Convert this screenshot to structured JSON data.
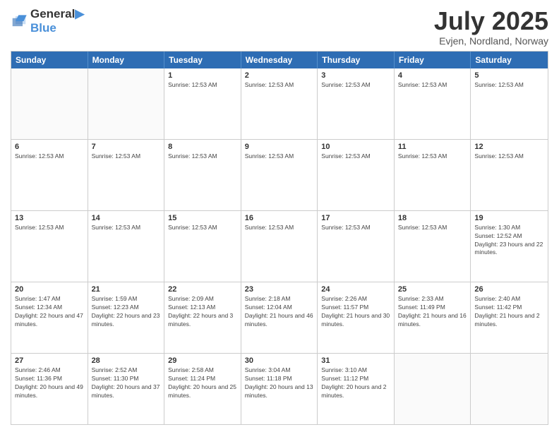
{
  "header": {
    "logo_line1": "General",
    "logo_line2": "Blue",
    "title": "July 2025",
    "subtitle": "Evjen, Nordland, Norway"
  },
  "weekdays": [
    "Sunday",
    "Monday",
    "Tuesday",
    "Wednesday",
    "Thursday",
    "Friday",
    "Saturday"
  ],
  "rows": [
    [
      {
        "day": "",
        "info": ""
      },
      {
        "day": "",
        "info": ""
      },
      {
        "day": "1",
        "info": "Sunrise: 12:53 AM"
      },
      {
        "day": "2",
        "info": "Sunrise: 12:53 AM"
      },
      {
        "day": "3",
        "info": "Sunrise: 12:53 AM"
      },
      {
        "day": "4",
        "info": "Sunrise: 12:53 AM"
      },
      {
        "day": "5",
        "info": "Sunrise: 12:53 AM"
      }
    ],
    [
      {
        "day": "6",
        "info": "Sunrise: 12:53 AM"
      },
      {
        "day": "7",
        "info": "Sunrise: 12:53 AM"
      },
      {
        "day": "8",
        "info": "Sunrise: 12:53 AM"
      },
      {
        "day": "9",
        "info": "Sunrise: 12:53 AM"
      },
      {
        "day": "10",
        "info": "Sunrise: 12:53 AM"
      },
      {
        "day": "11",
        "info": "Sunrise: 12:53 AM"
      },
      {
        "day": "12",
        "info": "Sunrise: 12:53 AM"
      }
    ],
    [
      {
        "day": "13",
        "info": "Sunrise: 12:53 AM"
      },
      {
        "day": "14",
        "info": "Sunrise: 12:53 AM"
      },
      {
        "day": "15",
        "info": "Sunrise: 12:53 AM"
      },
      {
        "day": "16",
        "info": "Sunrise: 12:53 AM"
      },
      {
        "day": "17",
        "info": "Sunrise: 12:53 AM"
      },
      {
        "day": "18",
        "info": "Sunrise: 12:53 AM"
      },
      {
        "day": "19",
        "info": "Sunrise: 1:30 AM\nSunset: 12:52 AM\nDaylight: 23 hours and 22 minutes."
      }
    ],
    [
      {
        "day": "20",
        "info": "Sunrise: 1:47 AM\nSunset: 12:34 AM\nDaylight: 22 hours and 47 minutes."
      },
      {
        "day": "21",
        "info": "Sunrise: 1:59 AM\nSunset: 12:23 AM\nDaylight: 22 hours and 23 minutes."
      },
      {
        "day": "22",
        "info": "Sunrise: 2:09 AM\nSunset: 12:13 AM\nDaylight: 22 hours and 3 minutes."
      },
      {
        "day": "23",
        "info": "Sunrise: 2:18 AM\nSunset: 12:04 AM\nDaylight: 21 hours and 46 minutes."
      },
      {
        "day": "24",
        "info": "Sunrise: 2:26 AM\nSunset: 11:57 PM\nDaylight: 21 hours and 30 minutes."
      },
      {
        "day": "25",
        "info": "Sunrise: 2:33 AM\nSunset: 11:49 PM\nDaylight: 21 hours and 16 minutes."
      },
      {
        "day": "26",
        "info": "Sunrise: 2:40 AM\nSunset: 11:42 PM\nDaylight: 21 hours and 2 minutes."
      }
    ],
    [
      {
        "day": "27",
        "info": "Sunrise: 2:46 AM\nSunset: 11:36 PM\nDaylight: 20 hours and 49 minutes."
      },
      {
        "day": "28",
        "info": "Sunrise: 2:52 AM\nSunset: 11:30 PM\nDaylight: 20 hours and 37 minutes."
      },
      {
        "day": "29",
        "info": "Sunrise: 2:58 AM\nSunset: 11:24 PM\nDaylight: 20 hours and 25 minutes."
      },
      {
        "day": "30",
        "info": "Sunrise: 3:04 AM\nSunset: 11:18 PM\nDaylight: 20 hours and 13 minutes."
      },
      {
        "day": "31",
        "info": "Sunrise: 3:10 AM\nSunset: 11:12 PM\nDaylight: 20 hours and 2 minutes."
      },
      {
        "day": "",
        "info": ""
      },
      {
        "day": "",
        "info": ""
      }
    ]
  ]
}
